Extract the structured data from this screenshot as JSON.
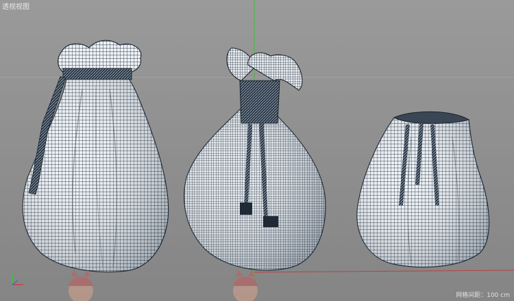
{
  "viewport": {
    "title": "透视视图",
    "grid_spacing_label": "网格间距：100 cm"
  },
  "colors": {
    "background": "#8f8f8f",
    "horizon_line": "#a0a0a0",
    "y_axis": "#3fbf3f",
    "x_axis": "#b84040",
    "cloth_white": "#eef2f6",
    "wire_dark": "#2c3744",
    "rope_dark": "#1f2a36"
  },
  "icons": {
    "axis_gizmo": "xyz-axis-icon",
    "bags": [
      "drawstring-bag-left",
      "knotted-bag-center",
      "drawstring-bag-right"
    ],
    "character_thumbnails": [
      "character-head-icon",
      "character-head-icon"
    ]
  }
}
